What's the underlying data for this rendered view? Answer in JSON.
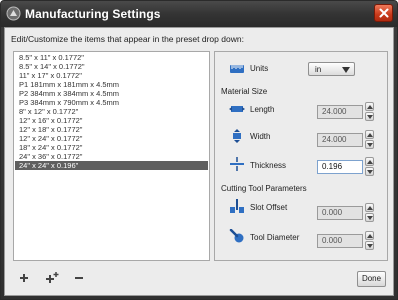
{
  "window": {
    "title": "Manufacturing Settings"
  },
  "instructions": "Edit/Customize the items that appear in the preset drop down:",
  "presets": [
    "8.5\" x 11\" x 0.1772\"",
    "8.5\" x 14\" x 0.1772\"",
    "11\" x 17\" x 0.1772\"",
    "P1 181mm x 181mm x 4.5mm",
    "P2 384mm x 384mm x 4.5mm",
    "P3 384mm x 790mm x 4.5mm",
    "8\" x 12\" x 0.1772\"",
    "12\" x 16\" x 0.1772\"",
    "12\" x 18\" x 0.1772\"",
    "12\" x 24\" x 0.1772\"",
    "18\" x 24\" x 0.1772\"",
    "24\" x 36\" x 0.1772\"",
    "24\" x 24\" x 0.196\""
  ],
  "selected_preset_index": 12,
  "settings": {
    "units_label": "Units",
    "units_value": "in",
    "material_size_label": "Material Size",
    "length_label": "Length",
    "length_value": "24.000",
    "width_label": "Width",
    "width_value": "24.000",
    "thickness_label": "Thickness",
    "thickness_value": "0.196",
    "cutting_tool_label": "Cutting Tool Parameters",
    "slot_offset_label": "Slot Offset",
    "slot_offset_value": "0.000",
    "tool_diameter_label": "Tool Diameter",
    "tool_diameter_value": "0.000"
  },
  "buttons": {
    "done_label": "Done"
  },
  "icons": {
    "add": "plus-icon",
    "duplicate": "duplicate-plus-icon",
    "remove": "minus-icon",
    "close": "close-icon"
  },
  "colors": {
    "accent_blue": "#2f6fc2",
    "selected_row": "#5f5f5f",
    "close_red": "#c8391a"
  }
}
